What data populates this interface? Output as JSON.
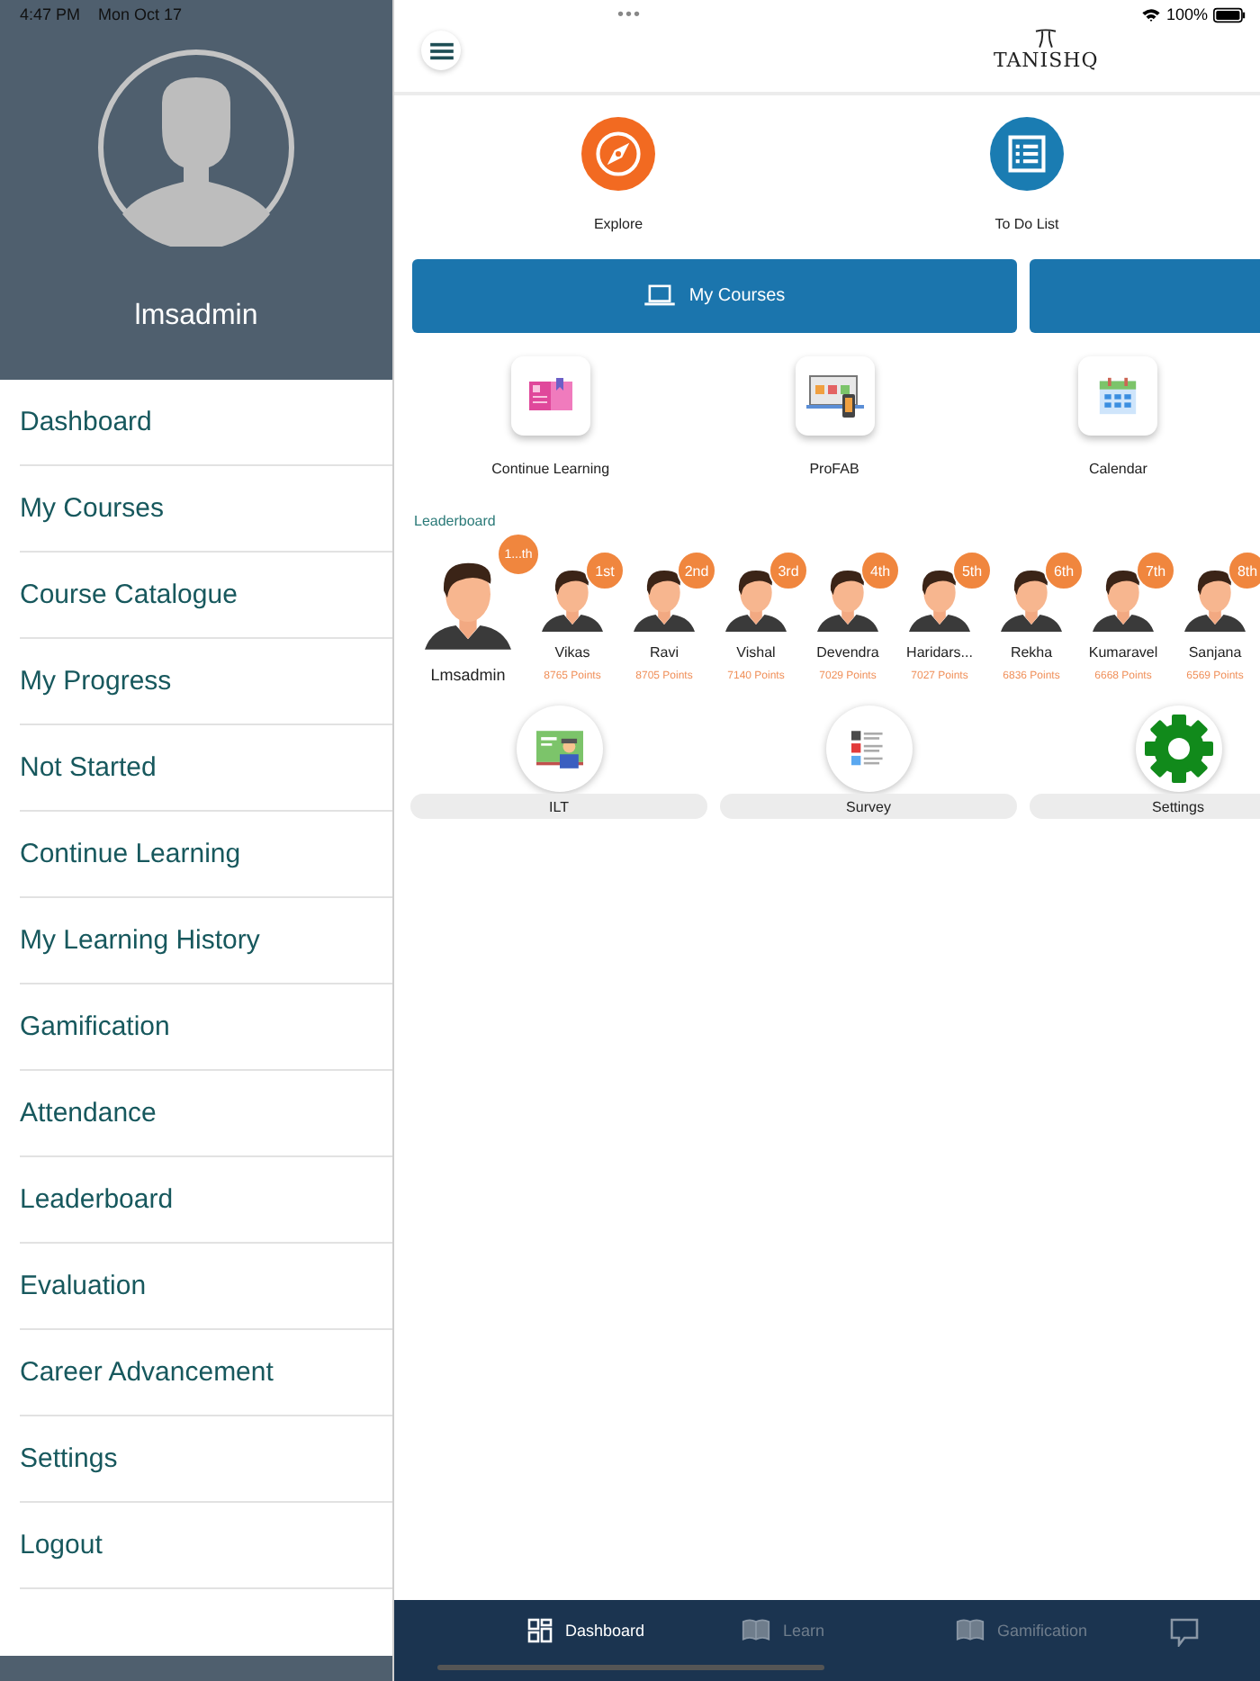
{
  "status_bar": {
    "time": "4:47 PM",
    "date": "Mon Oct 17",
    "dots": "•••",
    "battery": "100%"
  },
  "drawer": {
    "user_name": "lmsadmin",
    "items": [
      {
        "label": "Dashboard"
      },
      {
        "label": "My Courses"
      },
      {
        "label": "Course Catalogue"
      },
      {
        "label": "My Progress"
      },
      {
        "label": "Not Started"
      },
      {
        "label": "Continue Learning"
      },
      {
        "label": "My Learning History"
      },
      {
        "label": "Gamification"
      },
      {
        "label": "Attendance"
      },
      {
        "label": "Leaderboard"
      },
      {
        "label": "Evaluation"
      },
      {
        "label": "Career Advancement"
      },
      {
        "label": "Settings"
      },
      {
        "label": "Logout"
      }
    ]
  },
  "header": {
    "logo": "TANISHQ"
  },
  "quick_actions": [
    {
      "kind": "explore",
      "label": "Explore"
    },
    {
      "kind": "todo",
      "label": "To Do List"
    }
  ],
  "course_buttons": [
    {
      "kind": "labeled",
      "label": "My Courses"
    },
    {
      "kind": "unlabeled"
    }
  ],
  "shortcuts": [
    {
      "kind": "book",
      "label": "Continue Learning"
    },
    {
      "kind": "profab",
      "label": "ProFAB"
    },
    {
      "kind": "calendar",
      "label": "Calendar"
    }
  ],
  "leaderboard": {
    "title": "Leaderboard",
    "me": {
      "name": "Lmsadmin",
      "rank": "1...th"
    },
    "leaders": [
      {
        "name": "Vikas",
        "rank": "1st",
        "points": "8765 Points"
      },
      {
        "name": "Ravi",
        "rank": "2nd",
        "points": "8705 Points"
      },
      {
        "name": "Vishal",
        "rank": "3rd",
        "points": "7140 Points"
      },
      {
        "name": "Devendra",
        "rank": "4th",
        "points": "7029 Points"
      },
      {
        "name": "Haridars...",
        "rank": "5th",
        "points": "7027 Points"
      },
      {
        "name": "Rekha",
        "rank": "6th",
        "points": "6836 Points"
      },
      {
        "name": "Kumaravel",
        "rank": "7th",
        "points": "6668 Points"
      },
      {
        "name": "Sanjana",
        "rank": "8th",
        "points": "6569 Points"
      }
    ]
  },
  "modules": [
    {
      "kind": "ilt",
      "label": "ILT"
    },
    {
      "kind": "survey",
      "label": "Survey"
    },
    {
      "kind": "settings",
      "label": "Settings"
    }
  ],
  "bottom_tabs": [
    {
      "kind": "dashboard",
      "label": "Dashboard",
      "selected": true
    },
    {
      "kind": "book",
      "label": "Learn",
      "selected": false
    },
    {
      "kind": "book",
      "label": "Gamification",
      "selected": false
    },
    {
      "kind": "chat",
      "selected": false
    }
  ]
}
